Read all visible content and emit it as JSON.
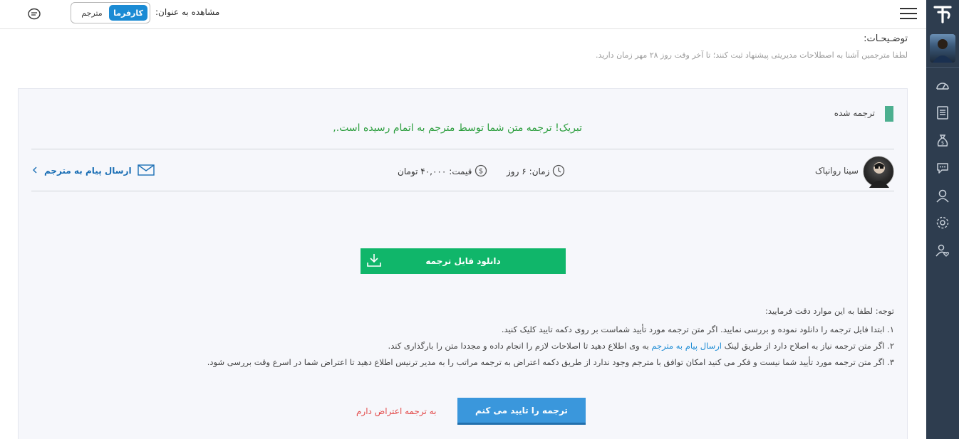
{
  "header": {
    "view_as_label": "مشاهده به عنوان:",
    "toggle_active": "کارفرما",
    "toggle_inactive": "مترجم"
  },
  "description": {
    "title": "توضـیحـات:",
    "text": "لطفا مترجمین آشنا به اصطلاحات مدیریتی پیشنهاد ثبت کنند؛ تا آخر وقت روز ۲۸ مهر زمان دارید."
  },
  "project": {
    "status": "ترجمه شده",
    "congrats": "تبریک! ترجمه متن شما توسط مترجم به اتمام رسیده است.,",
    "translator_name": "سینا روانپاک",
    "time_label": "زمان:",
    "time_value": "۶ روز",
    "price_label": "قیمت:",
    "price_value": "۴۰,۰۰۰ تومان",
    "message_link": "ارسال پیام به مترجم",
    "download_button": "دانلود فایل ترجمه"
  },
  "notes": {
    "title": "توجه: لطفا به این موارد دقت فرمایید:",
    "line1": "۱. ابتدا فایل ترجمه را دانلود نموده و بررسی نمایید. اگر متن ترجمه مورد تأیید شماست بر روی دکمه تایید کلیک کنید.",
    "line2_before": "۲. اگر متن ترجمه نیاز به اصلاح دارد از طریق لینک",
    "line2_link": "ارسال پیام به مترجم",
    "line2_after": "به وی اطلاع دهید تا اصلاحات لازم را انجام داده و مجددا متن را بارگذاری کند.",
    "line3": "۳. اگر متن ترجمه مورد تأیید شما نیست و فکر می کنید امکان توافق با مترجم وجود ندارد از طریق دکمه اعتراض به ترجمه مراتب را به مدیر ترنیس اطلاع دهید تا اعتراض شما در اسرع وقت بررسی شود."
  },
  "actions": {
    "approve_button": "ترجمه را تایید می کنم",
    "object_link": "به ترجمه اعتراض دارم"
  },
  "colors": {
    "sidebar": "#2e3d4f",
    "toggle_active": "#1b8bd4",
    "download_button": "#10b66a",
    "approve_button": "#3a97dc",
    "object_link": "#e34d4d",
    "congrats_text": "#2c9e3e"
  },
  "icons": [
    "logo-icon",
    "dashboard-icon",
    "document-icon",
    "money-bag-icon",
    "chat-icon",
    "user-icon",
    "settings-icon",
    "user-heart-icon",
    "menu-icon",
    "message-icon",
    "clock-icon",
    "dollar-icon",
    "envelope-icon",
    "chevron-left-icon",
    "download-icon"
  ]
}
